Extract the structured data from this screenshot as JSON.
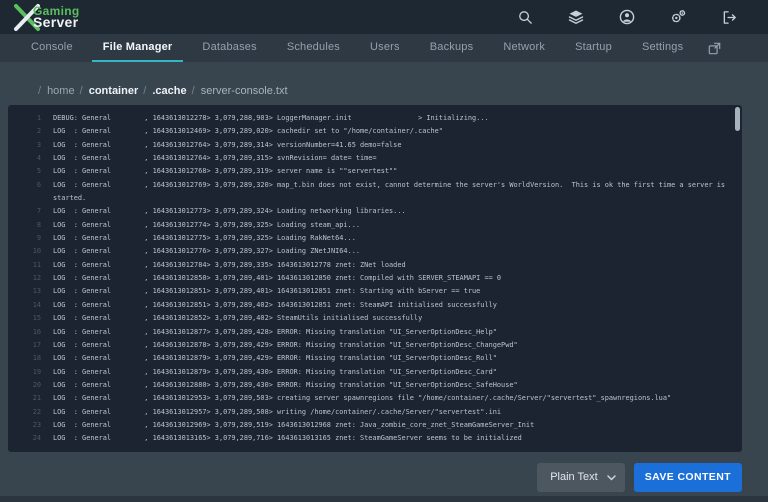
{
  "header": {
    "logo": {
      "line1": "Gaming",
      "line2": "Server"
    },
    "icons": [
      {
        "name": "search-icon"
      },
      {
        "name": "layers-icon"
      },
      {
        "name": "user-icon"
      },
      {
        "name": "gears-icon"
      },
      {
        "name": "logout-icon"
      }
    ]
  },
  "nav": {
    "tabs": [
      {
        "label": "Console"
      },
      {
        "label": "File Manager",
        "cls": "active"
      },
      {
        "label": "Databases"
      },
      {
        "label": "Schedules"
      },
      {
        "label": "Users"
      },
      {
        "label": "Backups"
      },
      {
        "label": "Network"
      },
      {
        "label": "Startup"
      },
      {
        "label": "Settings"
      }
    ],
    "external_icon": "open-in-new-icon"
  },
  "breadcrumb": {
    "separator": "/",
    "segments": [
      {
        "label": "home",
        "cls": "dim"
      },
      {
        "label": "container",
        "cls": "bright"
      },
      {
        "label": ".cache",
        "cls": "bright"
      },
      {
        "label": "server-console.txt",
        "cls": "file"
      }
    ]
  },
  "editor": {
    "file_name": "server-console.txt",
    "lines": [
      {
        "n": 1,
        "text": "DEBUG: General        , 1643613012278> 3,079,288,903> LoggerManager.init                > Initializing..."
      },
      {
        "n": 2,
        "text": "LOG  : General        , 1643613012469> 3,079,289,020> cachedir set to \"/home/container/.cache\""
      },
      {
        "n": 3,
        "text": "LOG  : General        , 1643613012764> 3,079,289,314> versionNumber=41.65 demo=false"
      },
      {
        "n": 4,
        "text": "LOG  : General        , 1643613012764> 3,079,289,315> svnRevision= date= time="
      },
      {
        "n": 5,
        "text": "LOG  : General        , 1643613012768> 3,079,289,319> server name is \"\"servertest\"\""
      },
      {
        "n": 6,
        "text": "LOG  : General        , 1643613012769> 3,079,289,320> map_t.bin does not exist, cannot determine the server's WorldVersion.  This is ok the first time a server is started."
      },
      {
        "n": 7,
        "text": "LOG  : General        , 1643613012773> 3,079,289,324> Loading networking libraries..."
      },
      {
        "n": 8,
        "text": "LOG  : General        , 1643613012774> 3,079,289,325> Loading steam_api..."
      },
      {
        "n": 9,
        "text": "LOG  : General        , 1643613012775> 3,079,289,325> Loading RakNet64..."
      },
      {
        "n": 10,
        "text": "LOG  : General        , 1643613012776> 3,079,289,327> Loading ZNetJNI64..."
      },
      {
        "n": 11,
        "text": "LOG  : General        , 1643613012784> 3,079,289,335> 1643613012778 znet: ZNet loaded"
      },
      {
        "n": 12,
        "text": "LOG  : General        , 1643613012850> 3,079,289,401> 1643613012850 znet: Compiled with SERVER_STEAMAPI == 0"
      },
      {
        "n": 13,
        "text": "LOG  : General        , 1643613012851> 3,079,289,401> 1643613012851 znet: Starting with bServer == true"
      },
      {
        "n": 14,
        "text": "LOG  : General        , 1643613012851> 3,079,289,402> 1643613012851 znet: SteamAPI initialised successfully"
      },
      {
        "n": 15,
        "text": "LOG  : General        , 1643613012852> 3,079,289,402> SteamUtils initialised successfully"
      },
      {
        "n": 16,
        "text": "LOG  : General        , 1643613012877> 3,079,289,428> ERROR: Missing translation \"UI_ServerOptionDesc_Help\""
      },
      {
        "n": 17,
        "text": "LOG  : General        , 1643613012878> 3,079,289,429> ERROR: Missing translation \"UI_ServerOptionDesc_ChangePwd\""
      },
      {
        "n": 18,
        "text": "LOG  : General        , 1643613012879> 3,079,289,429> ERROR: Missing translation \"UI_ServerOptionDesc_Roll\""
      },
      {
        "n": 19,
        "text": "LOG  : General        , 1643613012879> 3,079,289,430> ERROR: Missing translation \"UI_ServerOptionDesc_Card\""
      },
      {
        "n": 20,
        "text": "LOG  : General        , 1643613012880> 3,079,289,430> ERROR: Missing translation \"UI_ServerOptionDesc_SafeHouse\""
      },
      {
        "n": 21,
        "text": "LOG  : General        , 1643613012953> 3,079,289,503> creating server spawnregions file \"/home/container/.cache/Server/\"servertest\"_spawnregions.lua\""
      },
      {
        "n": 22,
        "text": "LOG  : General        , 1643613012957> 3,079,289,508> writing /home/container/.cache/Server/\"servertest\".ini"
      },
      {
        "n": 23,
        "text": "LOG  : General        , 1643613012969> 3,079,289,519> 1643613012968 znet: Java_zombie_core_znet_SteamGameServer_Init"
      },
      {
        "n": 24,
        "text": "LOG  : General        , 1643613013165> 3,079,289,716> 1643613013165 znet: SteamGameServer seems to be initialized"
      }
    ]
  },
  "actions": {
    "language_label": "Plain Text",
    "save_label": "SAVE CONTENT"
  },
  "colors": {
    "header_bg": "#1e2832",
    "nav_bg": "#2e3944",
    "page_bg": "#38444e",
    "editor_bg": "#1d2431",
    "accent_teal": "#34b6c4",
    "save_button_blue": "#1b6fd8",
    "logo_green": "#5bbf5e"
  }
}
